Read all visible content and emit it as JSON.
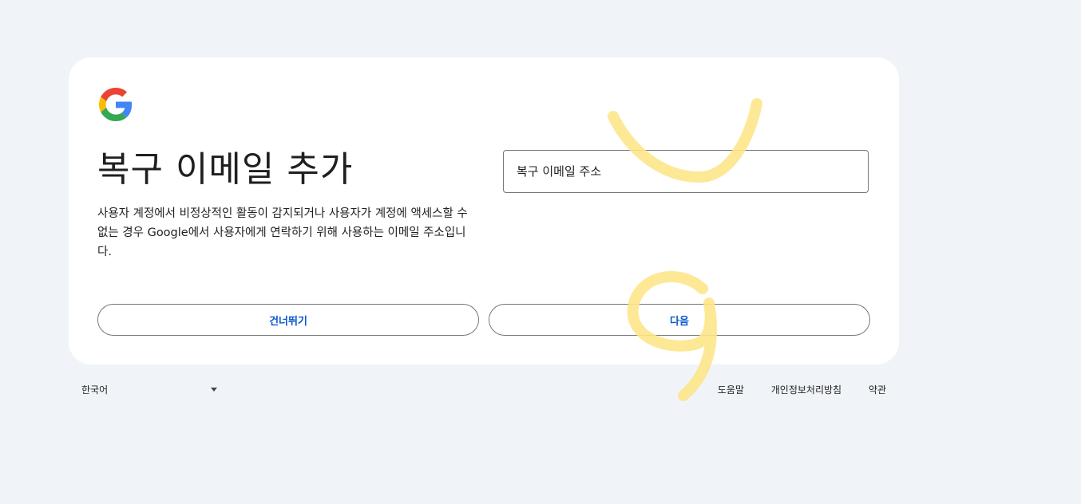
{
  "brand": {
    "logo_icon": "google-g-icon",
    "colors": {
      "blue": "#4285F4",
      "red": "#EA4335",
      "yellow": "#FBBC05",
      "green": "#34A853"
    }
  },
  "form": {
    "title": "복구 이메일 추가",
    "description": "사용자 계정에서 비정상적인 활동이 감지되거나 사용자가 계정에 액세스할 수 없는 경우 Google에서 사용자에게 연락하기 위해 사용하는 이메일 주소입니다.",
    "email_field": {
      "placeholder": "복구 이메일 주소",
      "value": ""
    },
    "skip_label": "건너뛰기",
    "next_label": "다음"
  },
  "footer": {
    "language": "한국어",
    "links": {
      "help": "도움말",
      "privacy": "개인정보처리방침",
      "terms": "약관"
    }
  },
  "theme": {
    "page_background": "#f0f4f9",
    "card_background": "#ffffff",
    "button_text": "#0b57d0",
    "annotation_highlight": "#fde68a"
  }
}
